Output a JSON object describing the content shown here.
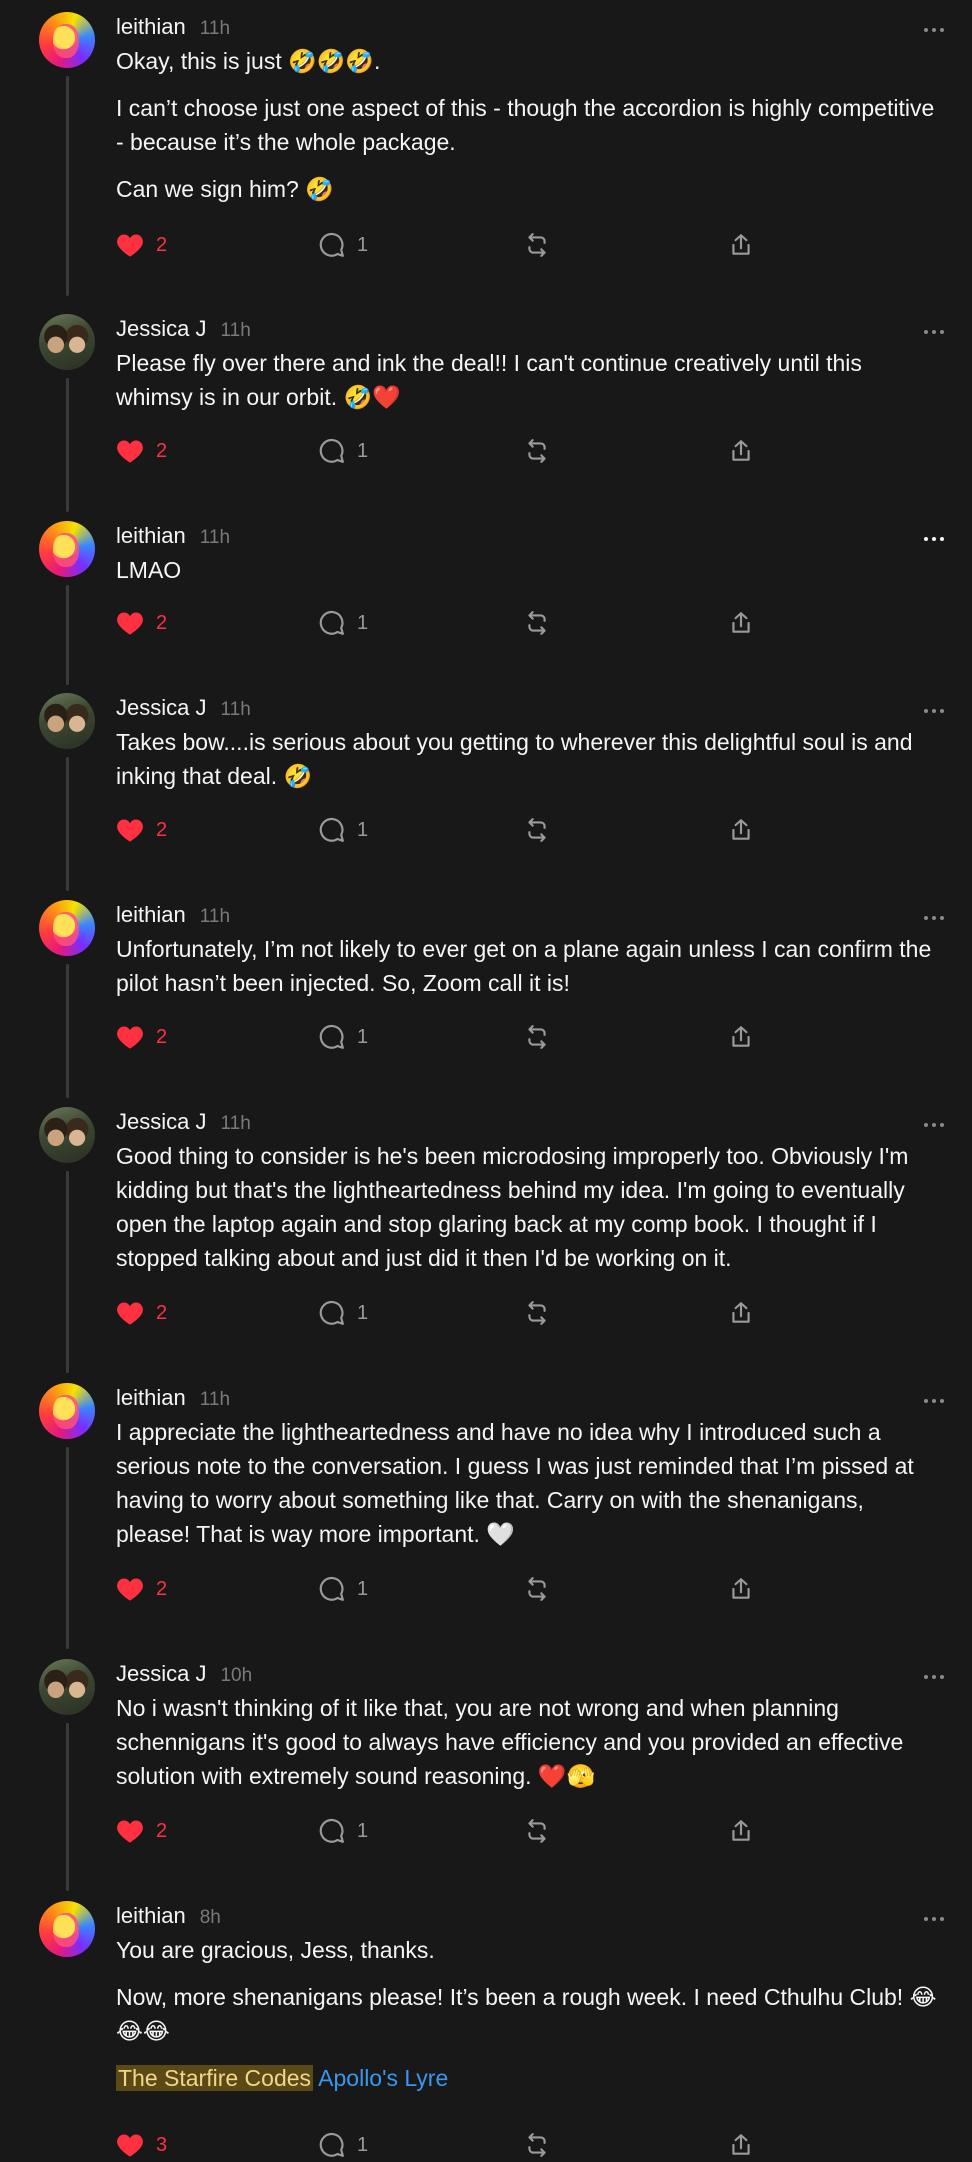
{
  "colors": {
    "background": "#181818",
    "text": "#f3f5f7",
    "muted": "#7a7a7a",
    "like": "#ff3040",
    "link": "#3897f0",
    "highlight_bg": "#5b4a16"
  },
  "icons": {
    "like": "heart-icon",
    "reply": "comment-icon",
    "repost": "repost-icon",
    "share": "share-icon",
    "more": "more-icon"
  },
  "posts": [
    {
      "username": "leithian",
      "time": "11h",
      "paragraphs": [
        "Okay, this is just 🤣🤣🤣.",
        "I can’t choose just one aspect of this - though the accordion is highly competitive - because it’s the whole package.",
        "Can we sign him? 🤣"
      ],
      "likes": "2",
      "replies": "1"
    },
    {
      "username": "Jessica J",
      "time": "11h",
      "paragraphs": [
        "Please fly over there and ink the deal!! I can't continue creatively until this whimsy is in our orbit. 🤣❤️"
      ],
      "likes": "2",
      "replies": "1"
    },
    {
      "username": "leithian",
      "time": "11h",
      "paragraphs": [
        "LMAO"
      ],
      "likes": "2",
      "replies": "1"
    },
    {
      "username": "Jessica J",
      "time": "11h",
      "paragraphs": [
        "Takes bow....is serious about you getting to wherever this delightful soul is and inking that deal. 🤣"
      ],
      "likes": "2",
      "replies": "1"
    },
    {
      "username": "leithian",
      "time": "11h",
      "paragraphs": [
        "Unfortunately, I’m not likely to ever get on a plane again unless I can confirm the pilot hasn’t been injected. So, Zoom call it is!"
      ],
      "likes": "2",
      "replies": "1"
    },
    {
      "username": "Jessica J",
      "time": "11h",
      "paragraphs": [
        "Good thing to consider is he's been microdosing improperly too. Obviously I'm kidding but that's the lightheartedness behind my idea. I'm going to eventually open the laptop again and stop glaring back at my comp book. I thought if I stopped talking about and just did it then I'd be working on it."
      ],
      "likes": "2",
      "replies": "1"
    },
    {
      "username": "leithian",
      "time": "11h",
      "paragraphs": [
        "I appreciate the lightheartedness and have no idea why I introduced such a serious note to the conversation. I guess I was just reminded that I’m pissed at having to worry about something like that. Carry on with the shenanigans, please! That is way more important. 🤍"
      ],
      "likes": "2",
      "replies": "1"
    },
    {
      "username": "Jessica J",
      "time": "10h",
      "paragraphs": [
        "No i wasn't thinking of it like that, you are not wrong and when planning schennigans it's good to always have efficiency and you provided an effective solution with extremely sound reasoning. ❤️🫣"
      ],
      "likes": "2",
      "replies": "1"
    },
    {
      "username": "leithian",
      "time": "8h",
      "paragraphs": [
        "You are gracious, Jess, thanks.",
        "Now, more shenanigans please! It’s been a rough week. I need Cthulhu Club! 😂😂😂"
      ],
      "tags": {
        "highlighted": "The Starfire Codes",
        "link": "Apollo's Lyre"
      },
      "likes": "3",
      "replies": "1"
    }
  ]
}
